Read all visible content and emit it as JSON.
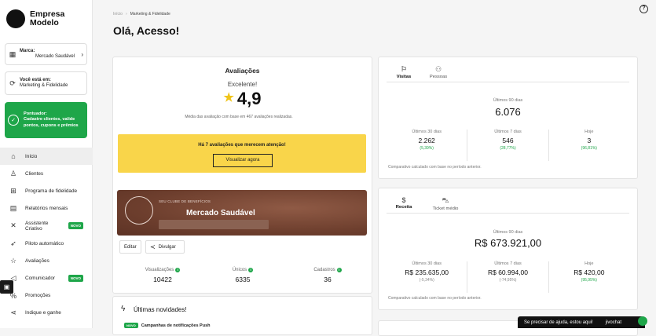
{
  "sidebar": {
    "company": "Empresa Modelo",
    "brand_label": "Marca:",
    "brand_value": "Mercado Saudável",
    "location_label": "Você está em:",
    "location_value": "Marketing & Fidelidade",
    "promo_title": "Pontuador:",
    "promo_text": "Cadastre clientes, valide pontos, cupons e prêmios",
    "items": [
      {
        "label": "Início",
        "icon": "home-icon"
      },
      {
        "label": "Clientes",
        "icon": "user-icon"
      },
      {
        "label": "Programa de fidelidade",
        "icon": "gift-icon"
      },
      {
        "label": "Relatórios mensais",
        "icon": "report-icon"
      },
      {
        "label": "Assistente Criativo",
        "icon": "magic-icon",
        "badge": "NOVO"
      },
      {
        "label": "Piloto automático",
        "icon": "rocket-icon"
      },
      {
        "label": "Avaliações",
        "icon": "star-icon"
      },
      {
        "label": "Comunicador",
        "icon": "megaphone-icon",
        "badge": "NOVO"
      },
      {
        "label": "Promoções",
        "icon": "percent-icon"
      },
      {
        "label": "Indique e ganhe",
        "icon": "share-icon"
      }
    ]
  },
  "header": {
    "crumb_home": "Início",
    "crumb_current": "Marketing & Fidelidade",
    "title": "Olá, Acesso!"
  },
  "reviews": {
    "title": "Avaliações",
    "rating_text": "Excelente!",
    "score": "4,9",
    "description": "Média das avaliação com base em 467 avaliações realizadas.",
    "alert_text": "Há 7 avaliações que merecem atenção!",
    "alert_button": "Visualizar agora"
  },
  "club": {
    "label": "SEU CLUBE DE BENEFÍCIOS",
    "name": "Mercado Saudável",
    "edit": "Editar",
    "share": "Divulgar"
  },
  "club_stats": [
    {
      "label": "Visualizações",
      "value": "10422"
    },
    {
      "label": "Únicos",
      "value": "6335"
    },
    {
      "label": "Cadastros",
      "value": "36"
    }
  ],
  "news": {
    "title": "Últimas novidades!",
    "badge": "NOVO",
    "item": "Campanhas de notificações Push"
  },
  "visits": {
    "tabs": [
      "Visitas",
      "Pessoas"
    ],
    "period": "Últimos 90 dias",
    "total": "6.076",
    "cols": [
      {
        "label": "Últimos 30 dias",
        "value": "2.262",
        "pct": "(5,39%)"
      },
      {
        "label": "Últimos 7 dias",
        "value": "546",
        "pct": "(28,77%)"
      },
      {
        "label": "Hoje",
        "value": "3",
        "pct": "(96,81%)"
      }
    ],
    "foot": "Comparativo calculado com base no período anterior."
  },
  "revenue": {
    "tabs": [
      "Receita",
      "Ticket médio"
    ],
    "period": "Últimos 90 dias",
    "total": "R$ 673.921,00",
    "cols": [
      {
        "label": "Últimos 30 dias",
        "value": "R$ 235.635,00",
        "pct": "(-5,34%)"
      },
      {
        "label": "Últimos 7 dias",
        "value": "R$ 60.994,00",
        "pct": "(-74,95%)"
      },
      {
        "label": "Hoje",
        "value": "R$ 420,00",
        "pct": "(95,95%)"
      }
    ],
    "foot": "Comparativo calculado com base no período anterior."
  },
  "chat": {
    "text": "Se precisar de ajuda, estou aqui!",
    "brand": "jivochat"
  },
  "colors": {
    "accent": "#1ea649",
    "alert": "#f9d54a",
    "banner": "#6e3f2e"
  }
}
